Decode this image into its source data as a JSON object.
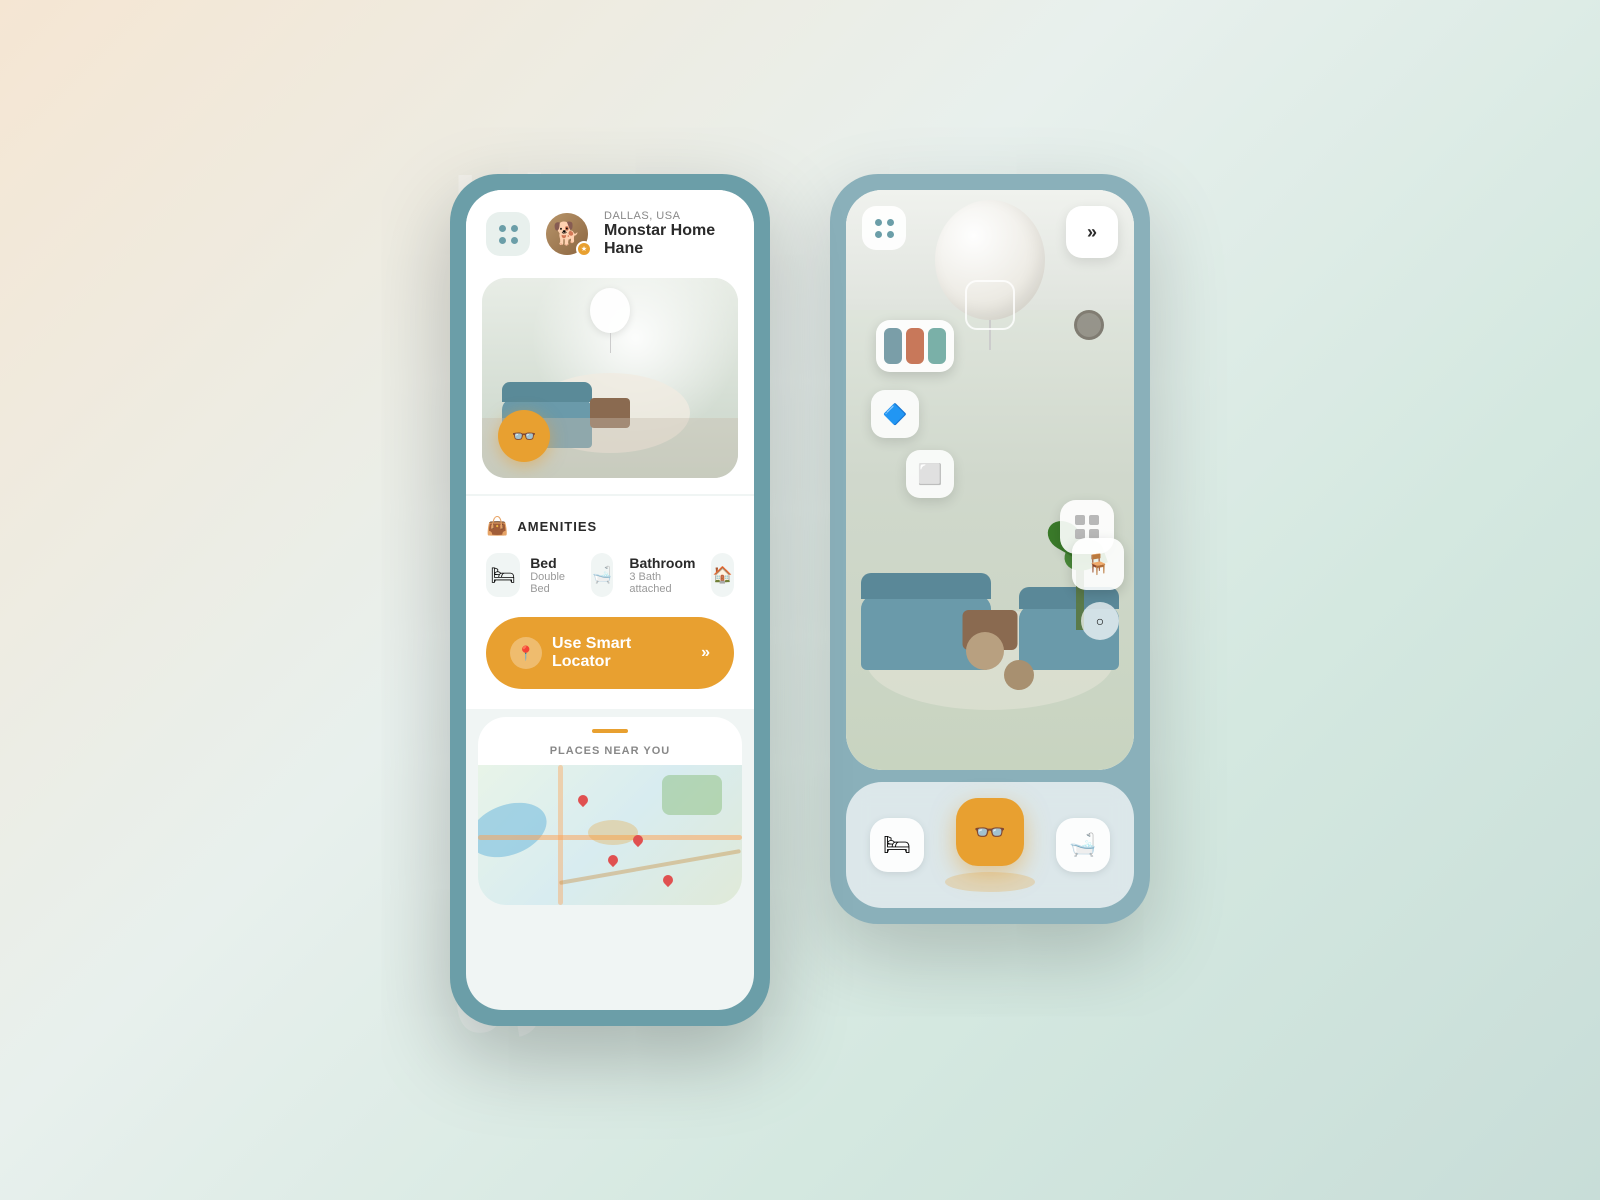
{
  "background_text": "SUPERSTYLE",
  "left_phone": {
    "header": {
      "location": "DALLAS, USA",
      "name": "Monstar Home Hane",
      "menu_dots_label": "menu"
    },
    "room_image": {
      "alt": "Living room interior"
    },
    "vr_button_label": "VR",
    "amenities": {
      "title": "AMENITIES",
      "items": [
        {
          "icon": "🛏",
          "name": "Bed",
          "description": "Double Bed"
        },
        {
          "icon": "🛁",
          "name": "Bathroom",
          "description": "3 Bath attached"
        }
      ]
    },
    "smart_locator": {
      "label": "Use Smart Locator",
      "arrow": "»"
    },
    "map": {
      "title": "PLACES NEAR YOU"
    }
  },
  "right_phone": {
    "forward_btn": "»",
    "toolbar": {
      "bed_icon": "🛏",
      "vr_icon": "👓",
      "bath_icon": "🛁"
    }
  }
}
